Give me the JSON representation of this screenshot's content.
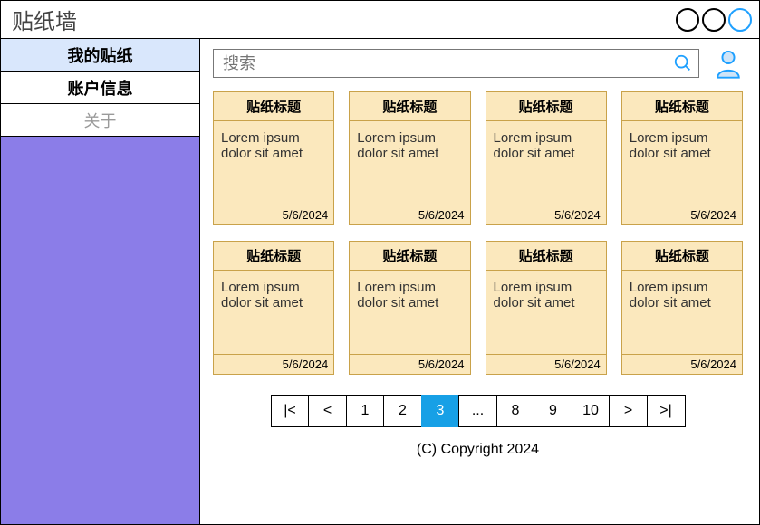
{
  "window": {
    "title": "贴纸墙"
  },
  "sidebar": {
    "items": [
      {
        "label": "我的贴纸",
        "active": true
      },
      {
        "label": "账户信息",
        "active": false
      },
      {
        "label": "关于",
        "active": false,
        "muted": true
      }
    ]
  },
  "search": {
    "placeholder": "搜索"
  },
  "cards": [
    {
      "title": "贴纸标题",
      "body": "Lorem ipsum dolor sit amet",
      "date": "5/6/2024"
    },
    {
      "title": "贴纸标题",
      "body": "Lorem ipsum dolor sit amet",
      "date": "5/6/2024"
    },
    {
      "title": "贴纸标题",
      "body": "Lorem ipsum dolor sit amet",
      "date": "5/6/2024"
    },
    {
      "title": "贴纸标题",
      "body": "Lorem ipsum dolor sit amet",
      "date": "5/6/2024"
    },
    {
      "title": "贴纸标题",
      "body": "Lorem ipsum dolor sit amet",
      "date": "5/6/2024"
    },
    {
      "title": "贴纸标题",
      "body": "Lorem ipsum dolor sit amet",
      "date": "5/6/2024"
    },
    {
      "title": "贴纸标题",
      "body": "Lorem ipsum dolor sit amet",
      "date": "5/6/2024"
    },
    {
      "title": "贴纸标题",
      "body": "Lorem ipsum dolor sit amet",
      "date": "5/6/2024"
    }
  ],
  "pagination": {
    "first": "|<",
    "prev": "<",
    "pages": [
      "1",
      "2",
      "3",
      "...",
      "8",
      "9",
      "10"
    ],
    "active": "3",
    "next": ">",
    "last": ">|"
  },
  "footer": "(C) Copyright 2024"
}
